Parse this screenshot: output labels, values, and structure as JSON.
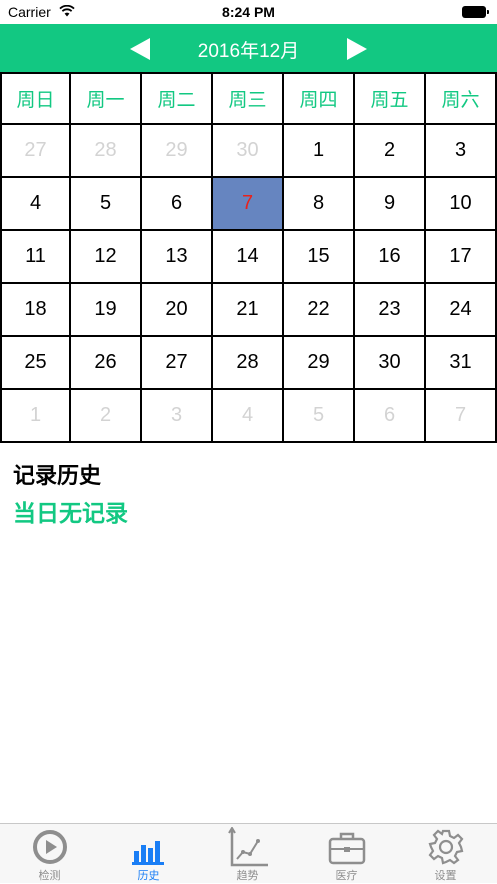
{
  "status_bar": {
    "carrier": "Carrier",
    "time": "8:24 PM"
  },
  "nav": {
    "title": "2016年12月",
    "prev_icon": "left-triangle-icon",
    "next_icon": "right-triangle-icon"
  },
  "calendar": {
    "weekdays": [
      "周日",
      "周一",
      "周二",
      "周三",
      "周四",
      "周五",
      "周六"
    ],
    "weeks": [
      [
        {
          "d": "27",
          "m": true
        },
        {
          "d": "28",
          "m": true
        },
        {
          "d": "29",
          "m": true
        },
        {
          "d": "30",
          "m": true
        },
        {
          "d": "1"
        },
        {
          "d": "2"
        },
        {
          "d": "3"
        }
      ],
      [
        {
          "d": "4"
        },
        {
          "d": "5"
        },
        {
          "d": "6"
        },
        {
          "d": "7",
          "sel": true
        },
        {
          "d": "8"
        },
        {
          "d": "9"
        },
        {
          "d": "10"
        }
      ],
      [
        {
          "d": "11"
        },
        {
          "d": "12"
        },
        {
          "d": "13"
        },
        {
          "d": "14"
        },
        {
          "d": "15"
        },
        {
          "d": "16"
        },
        {
          "d": "17"
        }
      ],
      [
        {
          "d": "18"
        },
        {
          "d": "19"
        },
        {
          "d": "20"
        },
        {
          "d": "21"
        },
        {
          "d": "22"
        },
        {
          "d": "23"
        },
        {
          "d": "24"
        }
      ],
      [
        {
          "d": "25"
        },
        {
          "d": "26"
        },
        {
          "d": "27"
        },
        {
          "d": "28"
        },
        {
          "d": "29"
        },
        {
          "d": "30"
        },
        {
          "d": "31"
        }
      ],
      [
        {
          "d": "1",
          "m": true
        },
        {
          "d": "2",
          "m": true
        },
        {
          "d": "3",
          "m": true
        },
        {
          "d": "4",
          "m": true
        },
        {
          "d": "5",
          "m": true
        },
        {
          "d": "6",
          "m": true
        },
        {
          "d": "7",
          "m": true
        }
      ]
    ],
    "selected_day": "7"
  },
  "record": {
    "title": "记录历史",
    "empty_text": "当日无记录"
  },
  "tabs": [
    {
      "label": "检测",
      "icon": "play-circle-icon",
      "active": false
    },
    {
      "label": "历史",
      "icon": "bar-chart-icon",
      "active": true
    },
    {
      "label": "趋势",
      "icon": "trend-chart-icon",
      "active": false
    },
    {
      "label": "医疗",
      "icon": "briefcase-icon",
      "active": false
    },
    {
      "label": "设置",
      "icon": "gear-icon",
      "active": false
    }
  ],
  "colors": {
    "brand_green": "#12c882",
    "selected_bg": "#6685c0",
    "selected_text": "#e8231c",
    "muted_text": "#d3d3d3",
    "tab_active": "#1a7ef5",
    "tab_inactive": "#8e8e8e"
  }
}
